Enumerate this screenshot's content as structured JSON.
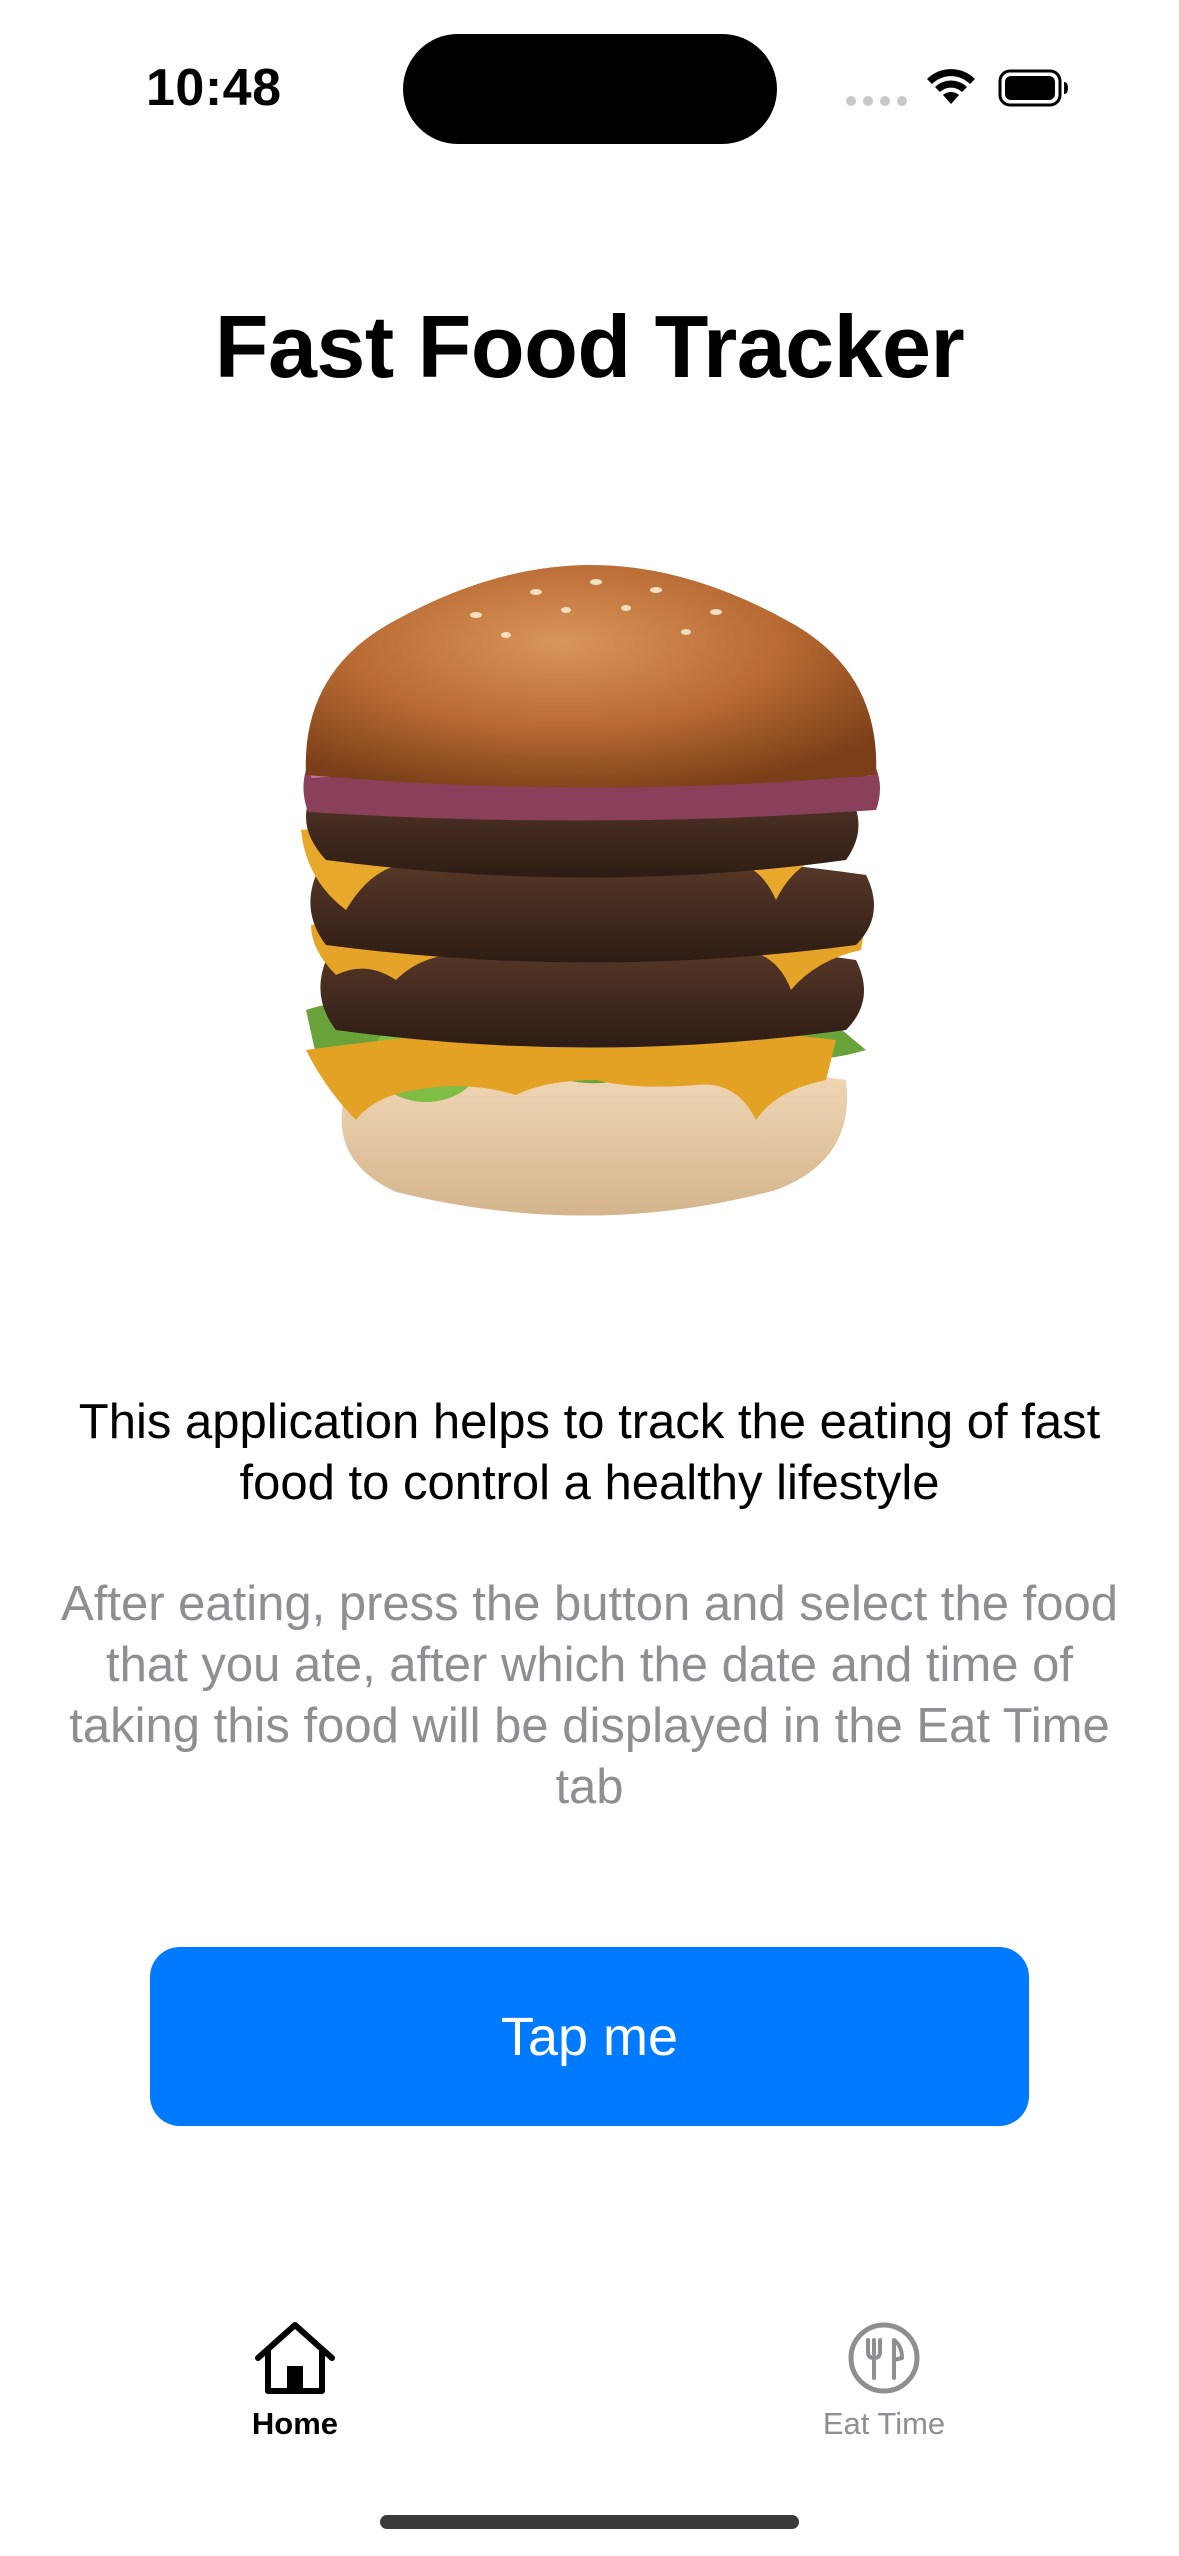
{
  "status_bar": {
    "time": "10:48"
  },
  "page": {
    "title": "Fast Food Tracker",
    "description": "This application helps to track the eating of fast food to control a healthy lifestyle",
    "instructions": "After eating, press the button and select the food that you ate, after which the date and time of taking this food will be displayed in the Eat Time tab",
    "button_label": "Tap me",
    "image_subject": "burger"
  },
  "tab_bar": {
    "tabs": [
      {
        "label": "Home",
        "icon": "house-icon",
        "selected": true
      },
      {
        "label": "Eat Time",
        "icon": "fork-knife-icon",
        "selected": false
      }
    ]
  },
  "colors": {
    "accent": "#007aff",
    "secondary_text": "#8e8e93"
  }
}
